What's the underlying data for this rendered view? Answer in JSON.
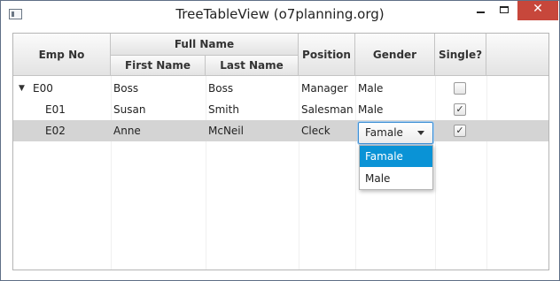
{
  "window": {
    "title": "TreeTableView (o7planning.org)",
    "close_glyph": "✕"
  },
  "table": {
    "group_header": "Full Name",
    "headers": {
      "emp_no": "Emp No",
      "first_name": "First Name",
      "last_name": "Last Name",
      "position": "Position",
      "gender": "Gender",
      "single": "Single?"
    },
    "rows": [
      {
        "emp_no": "E00",
        "first_name": "Boss",
        "last_name": "Boss",
        "position": "Manager",
        "gender": "Male",
        "single": false,
        "expanded": true
      },
      {
        "emp_no": "E01",
        "first_name": "Susan",
        "last_name": "Smith",
        "position": "Salesman",
        "gender": "Male",
        "single": true
      },
      {
        "emp_no": "E02",
        "first_name": "Anne",
        "last_name": "McNeil",
        "position": "Cleck",
        "gender": "Famale",
        "single": true,
        "selected": true
      }
    ],
    "disclosure_glyph": "▼",
    "check_glyph": "✓"
  },
  "gender_combo": {
    "value": "Famale",
    "options": [
      "Famale",
      "Male"
    ],
    "highlighted": "Famale"
  },
  "colors": {
    "selection_row": "#d4d4d4",
    "dropdown_highlight": "#0a93d6",
    "close_button": "#c7473b",
    "focus_border": "#3d8fd4"
  }
}
